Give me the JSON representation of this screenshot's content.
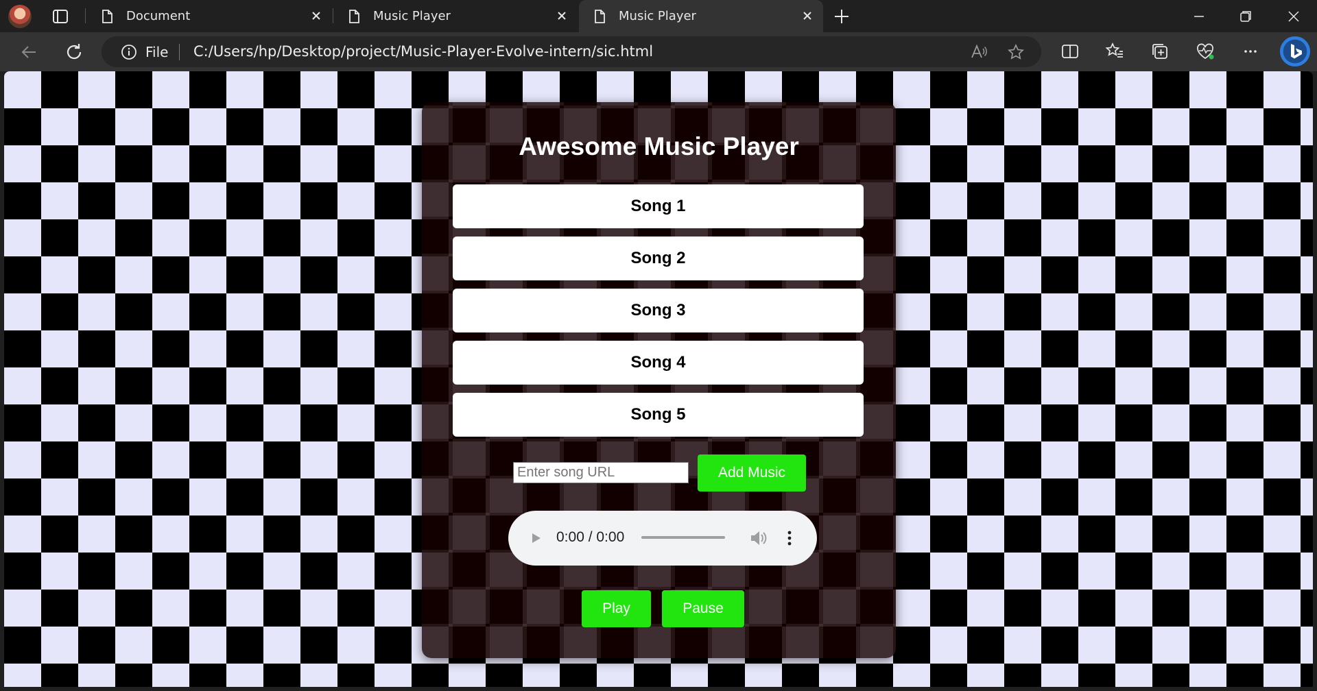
{
  "browser": {
    "tabs": [
      {
        "title": "Document"
      },
      {
        "title": "Music Player"
      },
      {
        "title": "Music Player"
      }
    ],
    "address": {
      "scheme_label": "File",
      "url": "C:/Users/hp/Desktop/project/Music-Player-Evolve-intern/sic.html"
    }
  },
  "page": {
    "title": "Awesome Music Player",
    "songs": [
      {
        "label": "Song 1"
      },
      {
        "label": "Song 2"
      },
      {
        "label": "Song 3"
      },
      {
        "label": "Song 4"
      },
      {
        "label": "Song 5"
      }
    ],
    "url_input": {
      "placeholder": "Enter song URL",
      "value": ""
    },
    "add_button": "Add Music",
    "audio": {
      "time": "0:00 / 0:00"
    },
    "play_button": "Play",
    "pause_button": "Pause"
  },
  "colors": {
    "accent_green": "#22e510",
    "checker_light": "#e6e6fa",
    "checker_dark": "#000000",
    "panel": "#140000"
  }
}
